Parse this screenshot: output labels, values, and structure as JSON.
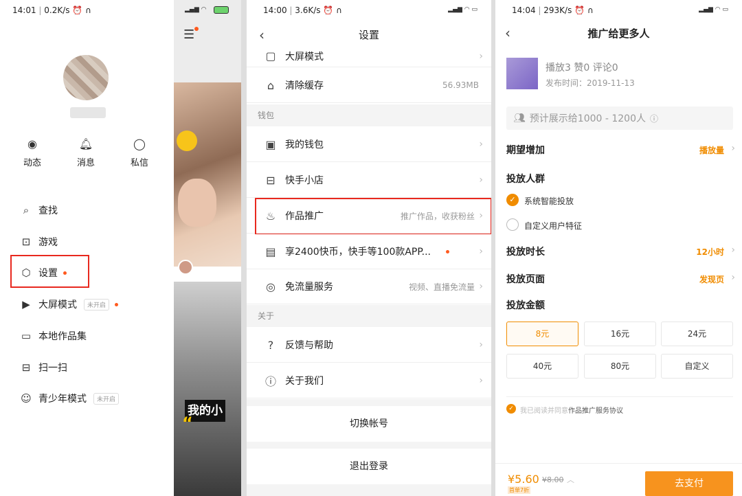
{
  "panel1": {
    "status_time": "14:01",
    "status_speed": "0.2K/s",
    "quick_actions": [
      {
        "label": "动态",
        "icon": "eye-icon"
      },
      {
        "label": "消息",
        "icon": "bell-icon"
      },
      {
        "label": "私信",
        "icon": "chat-bubble-icon"
      }
    ],
    "menu": [
      {
        "label": "查找",
        "icon": "search-icon"
      },
      {
        "label": "游戏",
        "icon": "gamepad-icon"
      },
      {
        "label": "设置",
        "icon": "gear-icon"
      },
      {
        "label": "大屏模式",
        "icon": "play-square-icon",
        "tag": "未开启"
      },
      {
        "label": "本地作品集",
        "icon": "folder-icon"
      },
      {
        "label": "扫一扫",
        "icon": "scan-icon"
      },
      {
        "label": "青少年模式",
        "icon": "smiley-icon",
        "tag": "未开启"
      }
    ]
  },
  "panel2": {
    "caption": "我的小"
  },
  "panel3": {
    "status_time": "14:00",
    "status_speed": "3.6K/s",
    "title": "设置",
    "rows": {
      "big_screen": "大屏模式",
      "clear_cache": "清除缓存",
      "cache_size": "56.93MB",
      "wallet_section": "钱包",
      "my_wallet": "我的钱包",
      "shop": "快手小店",
      "promote": "作品推广",
      "promote_hint": "推广作品，收获粉丝",
      "coins": "享2400快币，快手等100款APP...",
      "free_data": "免流量服务",
      "free_data_hint": "视频、直播免流量",
      "about_section": "关于",
      "feedback": "反馈与帮助",
      "about_us": "关于我们",
      "switch_account": "切换帐号",
      "logout": "退出登录"
    }
  },
  "panel4": {
    "status_time": "14:04",
    "status_speed": "293K/s",
    "title": "推广给更多人",
    "stats": "播放3 赞0 评论0",
    "publish_time": "发布时间：2019-11-13",
    "estimate": "预计展示给1000 - 1200人",
    "expect_label": "期望增加",
    "expect_value": "播放量",
    "audience_label": "投放人群",
    "audience_opt1": "系统智能投放",
    "audience_opt2": "自定义用户特征",
    "duration_label": "投放时长",
    "duration_value": "12小时",
    "page_label": "投放页面",
    "page_value": "发现页",
    "amount_label": "投放金额",
    "amounts": [
      "8元",
      "16元",
      "24元",
      "40元",
      "80元",
      "自定义"
    ],
    "agree_prefix": "我已阅读并同意",
    "agree_link": "作品推广服务协议",
    "price": "¥5.60",
    "orig_price": "¥8.00",
    "discount": "首单7折",
    "pay_button": "去支付"
  },
  "colors": {
    "accent_orange": "#f08c00",
    "highlight_red": "#e8281e",
    "badge_dot": "#ff5a1f"
  }
}
